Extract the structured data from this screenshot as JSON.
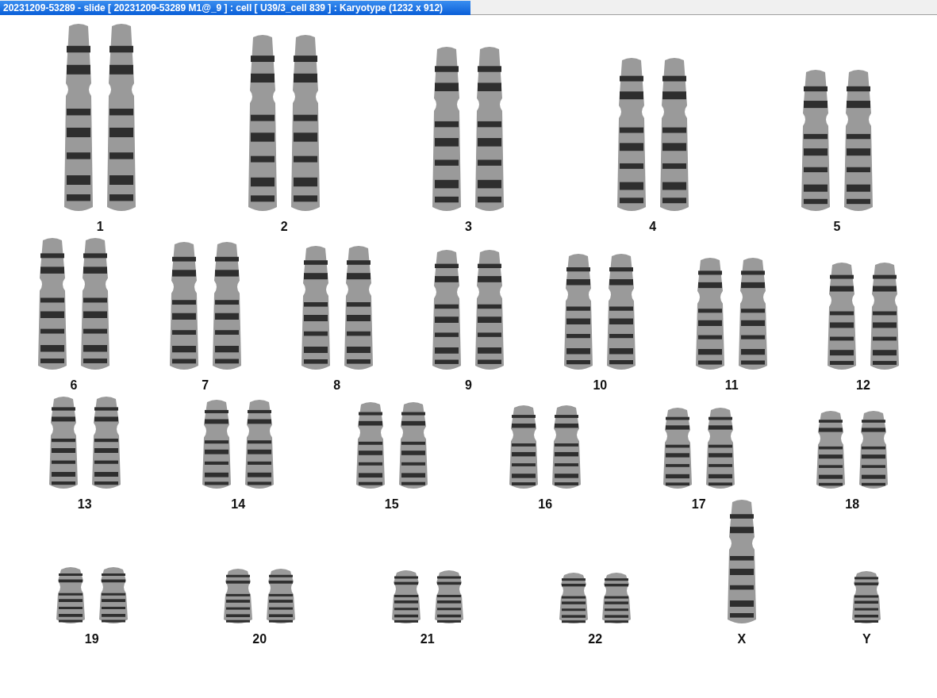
{
  "window": {
    "title": "20231209-53289 - slide [ 20231209-53289 M1@_9 ] : cell [ U39/3_cell 839 ] : Karyotype  (1232 x 912)"
  },
  "rows": [
    {
      "groups": [
        {
          "label": "1",
          "kind": "pair"
        },
        {
          "label": "2",
          "kind": "pair"
        },
        {
          "label": "3",
          "kind": "pair"
        },
        {
          "label": "4",
          "kind": "pair"
        },
        {
          "label": "5",
          "kind": "pair"
        }
      ]
    },
    {
      "groups": [
        {
          "label": "6",
          "kind": "pair"
        },
        {
          "label": "7",
          "kind": "pair"
        },
        {
          "label": "8",
          "kind": "pair"
        },
        {
          "label": "9",
          "kind": "pair"
        },
        {
          "label": "10",
          "kind": "pair"
        },
        {
          "label": "11",
          "kind": "pair"
        },
        {
          "label": "12",
          "kind": "pair"
        }
      ]
    },
    {
      "groups": [
        {
          "label": "13",
          "kind": "pair"
        },
        {
          "label": "14",
          "kind": "pair"
        },
        {
          "label": "15",
          "kind": "pair"
        },
        {
          "label": "16",
          "kind": "pair"
        },
        {
          "label": "17",
          "kind": "pair"
        },
        {
          "label": "18",
          "kind": "pair"
        }
      ]
    },
    {
      "groups": [
        {
          "label": "19",
          "kind": "pair"
        },
        {
          "label": "20",
          "kind": "pair"
        },
        {
          "label": "21",
          "kind": "pair"
        },
        {
          "label": "22",
          "kind": "pair"
        },
        {
          "label": "X",
          "kind": "single"
        },
        {
          "label": "Y",
          "kind": "single"
        }
      ]
    }
  ]
}
